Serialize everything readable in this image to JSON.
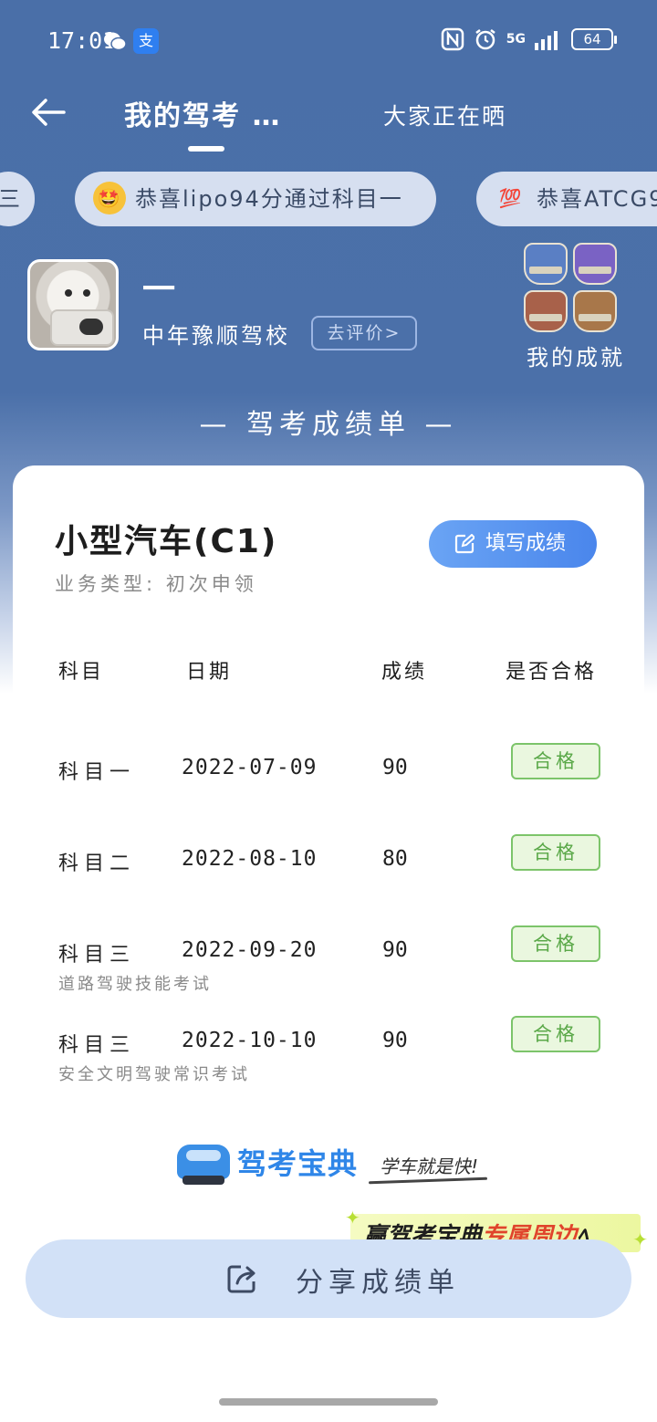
{
  "status_bar": {
    "time": "17:01",
    "app_icons": [
      "wechat-icon",
      "alipay-icon"
    ],
    "alipay_glyph": "支",
    "network": "5G",
    "battery": "64"
  },
  "nav": {
    "title": "我的驾考 …",
    "tab_other": "大家正在晒"
  },
  "ticker": {
    "items": [
      {
        "emoji": "",
        "text": "三"
      },
      {
        "emoji": "🤩",
        "text": "恭喜lipo94分通过科目一"
      },
      {
        "emoji": "💯",
        "text": "恭喜ATCG9"
      }
    ]
  },
  "profile": {
    "name": "一",
    "school": "中年豫顺驾校",
    "rate_button": "去评价>",
    "achievements_label": "我的成就"
  },
  "sheet_title": "— 驾考成绩单 —",
  "card": {
    "vehicle": "小型汽车(C1)",
    "business_type": "业务类型: 初次申领",
    "fill_button": "填写成绩",
    "headers": [
      "科目",
      "日期",
      "成绩",
      "是否合格"
    ],
    "rows": [
      {
        "subject": "科目一",
        "date": "2022-07-09",
        "score": "90",
        "status": "合格",
        "note": ""
      },
      {
        "subject": "科目二",
        "date": "2022-08-10",
        "score": "80",
        "status": "合格",
        "note": ""
      },
      {
        "subject": "科目三",
        "date": "2022-09-20",
        "score": "90",
        "status": "合格",
        "note": "道路驾驶技能考试"
      },
      {
        "subject": "科目三",
        "date": "2022-10-10",
        "score": "90",
        "status": "合格",
        "note": "安全文明驾驶常识考试"
      }
    ],
    "brand_name": "驾考宝典",
    "brand_slogan": "学车就是快!"
  },
  "promo": {
    "text_a": "赢驾考宝典",
    "text_b": "专属周边",
    "text_c": "ﾍ"
  },
  "share_button": "分享成绩单",
  "colors": {
    "header_bg": "#4a6fa8",
    "accent_blue": "#4a86ec",
    "pass_green": "#5aa848",
    "share_bg": "#d2e1f7"
  }
}
